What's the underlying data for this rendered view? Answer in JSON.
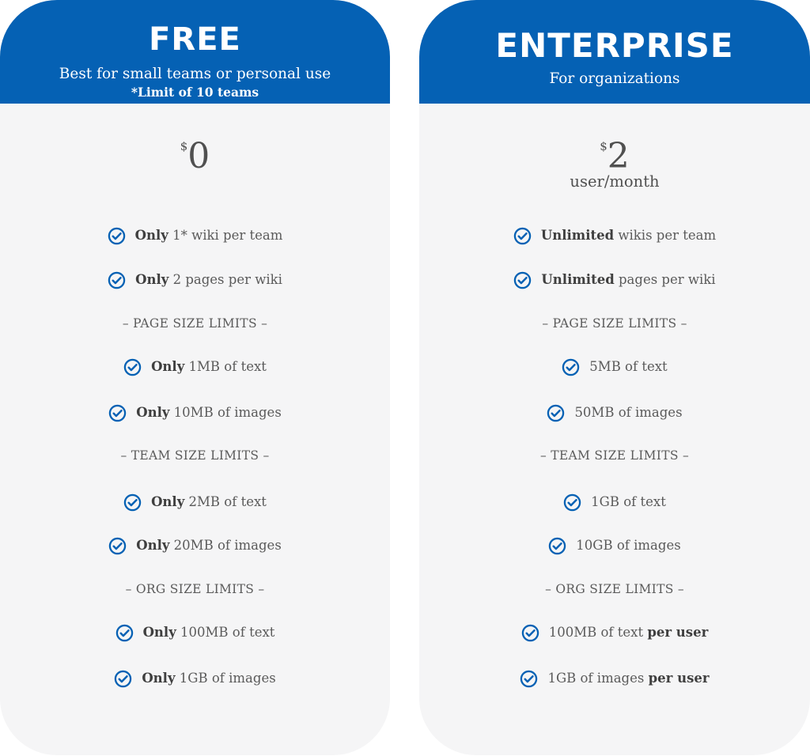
{
  "free": {
    "name": "FREE",
    "subtitle": "Best for small teams or personal use",
    "note": "*Limit of 10 teams",
    "currency": "$",
    "price": "0",
    "features": [
      {
        "bold": "Only",
        "text": " 1* wiki per team"
      },
      {
        "bold": "Only",
        "text": " 2 pages per wiki"
      },
      {
        "bold": "Only",
        "text": " 1MB of text"
      },
      {
        "bold": "Only",
        "text": " 10MB of images"
      },
      {
        "bold": "Only",
        "text": " 2MB of text"
      },
      {
        "bold": "Only",
        "text": " 20MB of images"
      },
      {
        "bold": "Only",
        "text": " 100MB of text"
      },
      {
        "bold": "Only",
        "text": " 1GB of images"
      }
    ],
    "sections": [
      "– PAGE SIZE LIMITS –",
      "– TEAM SIZE LIMITS –",
      "– ORG SIZE LIMITS –"
    ]
  },
  "enterprise": {
    "name": "ENTERPRISE",
    "subtitle": "For organizations",
    "currency": "$",
    "price": "2",
    "per": "user/month",
    "features": [
      {
        "bold": "Unlimited",
        "text": " wikis per team"
      },
      {
        "bold": "Unlimited",
        "text": " pages per wiki"
      },
      {
        "text": "5MB of text"
      },
      {
        "text": "50MB of images"
      },
      {
        "text": "1GB of text"
      },
      {
        "text": "10GB of images"
      },
      {
        "text": "100MB of text ",
        "bold_after": "per user"
      },
      {
        "text": "1GB of images ",
        "bold_after": "per user"
      }
    ],
    "sections": [
      "– PAGE SIZE LIMITS –",
      "– TEAM SIZE LIMITS –",
      "– ORG SIZE LIMITS –"
    ]
  },
  "icons": {
    "feature": "check-circle-icon"
  },
  "colors": {
    "brand": "#0561b4",
    "card": "#f5f5f6",
    "text": "#5a5a5a"
  }
}
